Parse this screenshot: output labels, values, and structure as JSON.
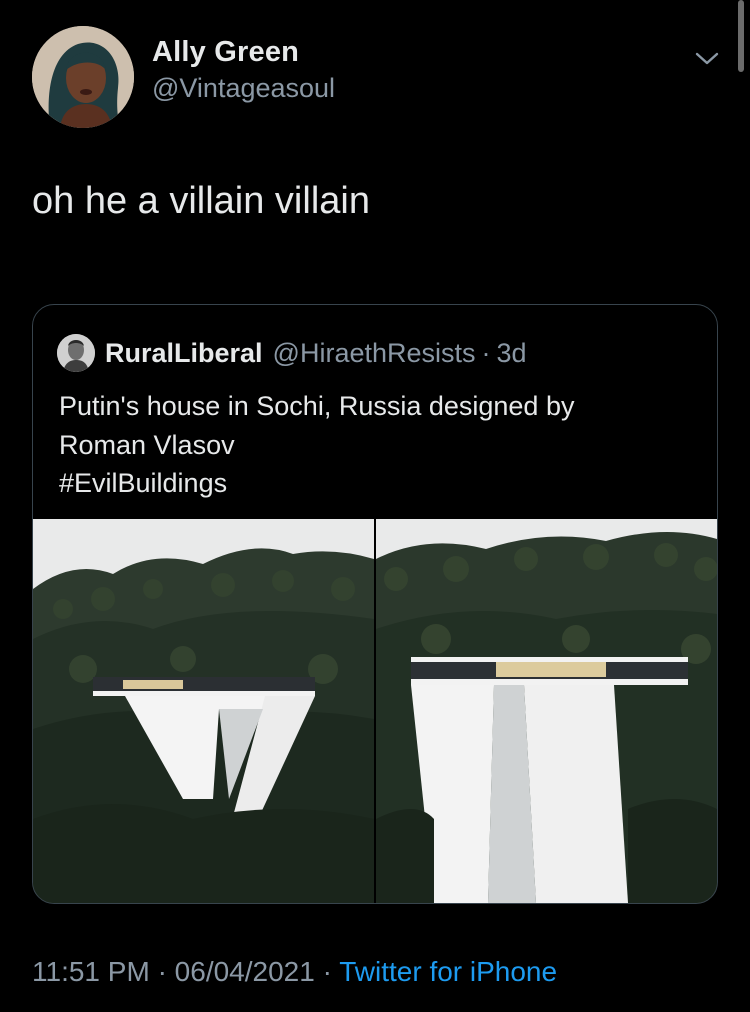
{
  "tweet": {
    "author": {
      "display_name": "Ally Green",
      "handle": "@Vintageasoul",
      "avatar_icon": "profile-photo"
    },
    "menu_icon": "chevron-down-icon",
    "text": "oh he a villain villain",
    "quoted": {
      "author": {
        "display_name": "RuralLiberal",
        "handle": "@HiraethResists",
        "separator": "·",
        "age": "3d"
      },
      "text_lines": [
        "Putin's house in Sochi, Russia designed by",
        "Roman Vlasov",
        "#EvilBuildings"
      ],
      "media": [
        {
          "description_icon": "building-photo-icon"
        },
        {
          "description_icon": "building-photo-icon"
        }
      ]
    },
    "footer": {
      "time": "11:51 PM",
      "sep1": "·",
      "date": "06/04/2021",
      "sep2": "·",
      "source": "Twitter for iPhone"
    }
  },
  "colors": {
    "background": "#000000",
    "text": "#e7e9ea",
    "muted": "#8b98a5",
    "link": "#1d9bf0",
    "border": "#38444d"
  }
}
